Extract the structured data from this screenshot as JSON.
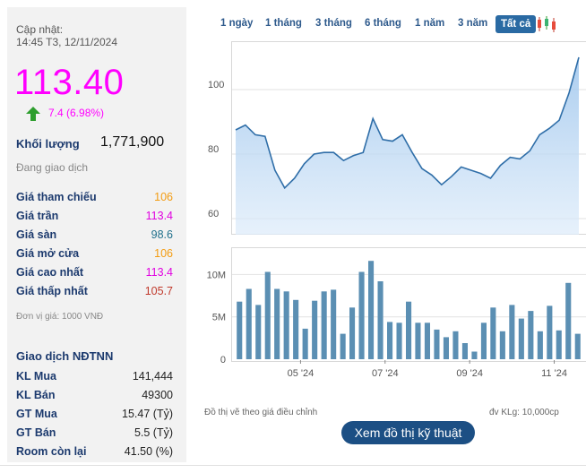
{
  "quote": {
    "updated_label": "Cập nhật:",
    "updated_time": "14:45 T3, 12/11/2024",
    "price": "113.40",
    "change": "7.4 (6.98%)",
    "volume_label": "Khối lượng",
    "volume_value": "1,771,900",
    "status": "Đang giao dịch",
    "colors": {
      "ceiling": "#ff00ff",
      "reference": "#f39c12",
      "floor": "#1f6f8b",
      "low": "#c0392b",
      "up": "#2e9e2e"
    }
  },
  "price_rows": [
    {
      "label": "Giá tham chiếu",
      "value": "106",
      "color": "#f39c12"
    },
    {
      "label": "Giá trần",
      "value": "113.4",
      "color": "#e000e0"
    },
    {
      "label": "Giá sàn",
      "value": "98.6",
      "color": "#1f6f8b"
    },
    {
      "label": "Giá mở cửa",
      "value": "106",
      "color": "#f39c12"
    },
    {
      "label": "Giá cao nhất",
      "value": "113.4",
      "color": "#e000e0"
    },
    {
      "label": "Giá thấp nhất",
      "value": "105.7",
      "color": "#c0392b"
    }
  ],
  "unit_note": "Đơn vị giá: 1000 VNĐ",
  "foreign": {
    "title": "Giao dịch NĐTNN",
    "rows": [
      {
        "label": "KL Mua",
        "value": "141,444"
      },
      {
        "label": "KL Bán",
        "value": "49300"
      },
      {
        "label": "GT Mua",
        "value": "15.47 (Tỷ)"
      },
      {
        "label": "GT Bán",
        "value": "5.5 (Tỷ)"
      },
      {
        "label": "Room còn lại",
        "value": "41.50 (%)"
      }
    ]
  },
  "tabs": [
    {
      "label": "1 ngày",
      "active": false
    },
    {
      "label": "1 tháng",
      "active": false
    },
    {
      "label": "3 tháng",
      "active": false
    },
    {
      "label": "6 tháng",
      "active": false
    },
    {
      "label": "1 năm",
      "active": false
    },
    {
      "label": "3 năm",
      "active": false
    },
    {
      "label": "Tất cả",
      "active": true
    }
  ],
  "chart_icon": "candlestick-icon",
  "chart_data": [
    {
      "type": "area",
      "ylim": [
        55,
        115
      ],
      "yticks": [
        60,
        80,
        100
      ],
      "values": [
        87.5,
        89,
        86,
        85.5,
        75,
        69.5,
        72.5,
        77,
        80,
        80.5,
        80.5,
        78,
        79.5,
        80.5,
        91,
        84.5,
        84,
        86,
        80.5,
        75.5,
        73.5,
        70.5,
        73,
        76,
        75,
        74,
        72.5,
        76.5,
        79,
        78.5,
        81,
        86,
        88,
        90.5,
        99,
        110
      ],
      "grid": true
    },
    {
      "type": "bar",
      "ylim": [
        0,
        13
      ],
      "yticks": [
        {
          "value": 0,
          "label": "0"
        },
        {
          "value": 5,
          "label": "5M"
        },
        {
          "value": 10,
          "label": "10M"
        }
      ],
      "values": [
        6.8,
        8.3,
        6.4,
        10.3,
        8.3,
        8.0,
        7.0,
        3.6,
        6.9,
        8.0,
        8.2,
        3.0,
        6.1,
        10.3,
        11.6,
        9.2,
        4.4,
        4.3,
        6.8,
        4.3,
        4.3,
        3.5,
        2.6,
        3.3,
        1.9,
        0.9,
        4.3,
        6.1,
        3.3,
        6.4,
        4.8,
        5.7,
        3.3,
        6.3,
        3.4,
        9.0,
        3.0
      ],
      "xticks": [
        {
          "index": 6.5,
          "label": "05 '24"
        },
        {
          "index": 15.5,
          "label": "07 '24"
        },
        {
          "index": 24.5,
          "label": "09 '24"
        },
        {
          "index": 33.5,
          "label": "11 '24"
        }
      ]
    }
  ],
  "notes": {
    "left": "Đồ thị vẽ theo giá điều chỉnh",
    "right": "đv KLg: 10,000cp"
  },
  "tech_button": "Xem đồ thị kỹ thuật"
}
